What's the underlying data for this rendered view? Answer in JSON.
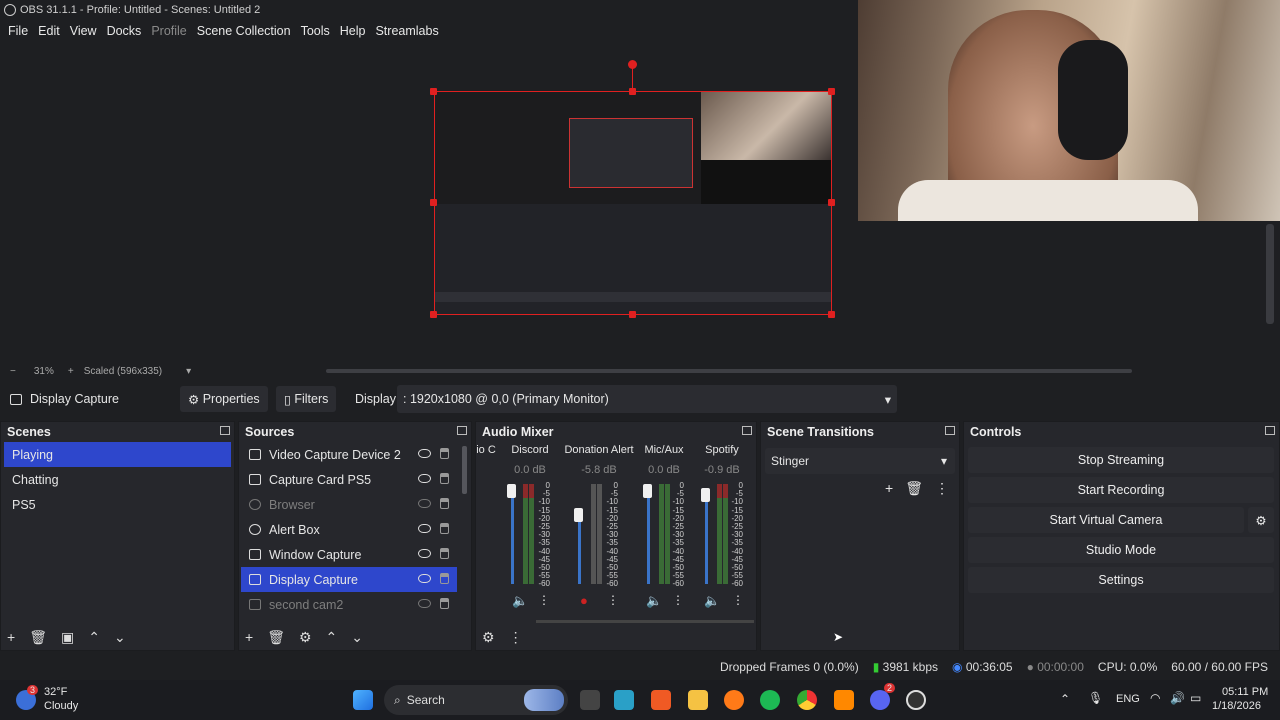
{
  "window": {
    "title": "OBS 31.1.1 - Profile: Untitled - Scenes: Untitled 2"
  },
  "menu": [
    "File",
    "Edit",
    "View",
    "Docks",
    "Profile",
    "Scene Collection",
    "Tools",
    "Help",
    "Streamlabs"
  ],
  "preview": {
    "zoom": "31%",
    "scaled": "Scaled (596x335)"
  },
  "context": {
    "source": "Display Capture",
    "properties": "Properties",
    "filters": "Filters",
    "display_label": "Display",
    "display_value": ": 1920x1080 @ 0,0 (Primary Monitor)"
  },
  "scenes": {
    "title": "Scenes",
    "items": [
      "Playing",
      "Chatting",
      "PS5"
    ],
    "selected": "Playing"
  },
  "sources": {
    "title": "Sources",
    "items": [
      "Video Capture Device 2",
      "Capture Card PS5",
      "Browser",
      "Alert Box",
      "Window Capture",
      "Display Capture",
      "second cam2"
    ],
    "selected": "Display Capture"
  },
  "mixer": {
    "title": "Audio Mixer",
    "cut": "io C",
    "channels": [
      {
        "name": "Discord",
        "db": "0.0 dB"
      },
      {
        "name": "Donation Alert",
        "db": "-5.8 dB"
      },
      {
        "name": "Mic/Aux",
        "db": "0.0 dB"
      },
      {
        "name": "Spotify",
        "db": "-0.9 dB"
      }
    ],
    "scale": [
      "0",
      "-5",
      "-10",
      "-15",
      "-20",
      "-25",
      "-30",
      "-35",
      "-40",
      "-45",
      "-50",
      "-55",
      "-60"
    ]
  },
  "transitions": {
    "title": "Scene Transitions",
    "value": "Stinger"
  },
  "controls": {
    "title": "Controls",
    "buttons": [
      "Stop Streaming",
      "Start Recording",
      "Start Virtual Camera",
      "Studio Mode",
      "Settings"
    ]
  },
  "status": {
    "dropped": "Dropped Frames 0 (0.0%)",
    "kbps": "3981 kbps",
    "stream_time": "00:36:05",
    "rec_time": "00:00:00",
    "cpu": "CPU: 0.0%",
    "fps": "60.00 / 60.00 FPS"
  },
  "taskbar": {
    "weather_temp": "32°F",
    "weather_desc": "Cloudy",
    "badge": "3",
    "search": "Search",
    "lang": "ENG",
    "time": "05:11 PM",
    "date": "1/18/2026",
    "discord_badge": "2"
  }
}
